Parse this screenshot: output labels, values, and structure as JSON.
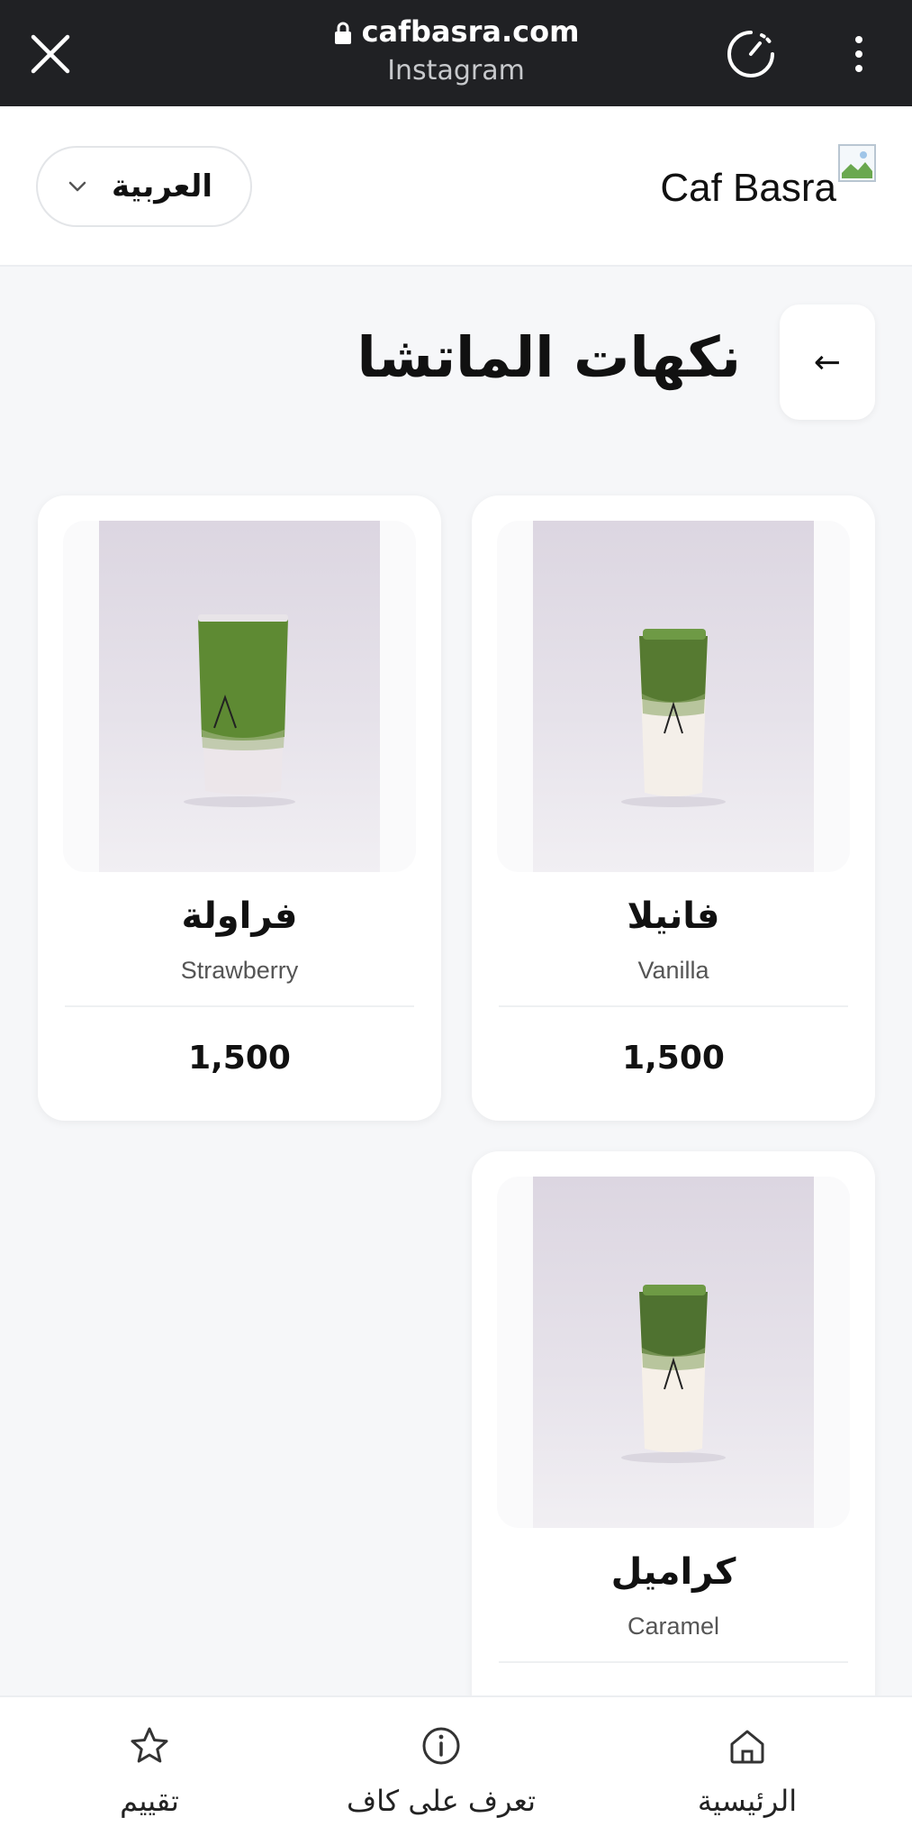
{
  "browser": {
    "url": "cafbasra.com",
    "source": "Instagram"
  },
  "header": {
    "language": "العربية",
    "brand": "Caf Basra"
  },
  "page": {
    "title": "نكهات الماتشا",
    "back_arrow": "←"
  },
  "products": [
    {
      "name_ar": "فانيلا",
      "name_en": "Vanilla",
      "price": "1,500"
    },
    {
      "name_ar": "فراولة",
      "name_en": "Strawberry",
      "price": "1,500"
    },
    {
      "name_ar": "كراميل",
      "name_en": "Caramel",
      "price": ""
    }
  ],
  "nav": {
    "home": "الرئيسية",
    "about": "تعرف على كاف",
    "rate": "تقييم"
  },
  "colors": {
    "browser_bar": "#202124",
    "page_background": "#f6f7f9",
    "matcha_green": "#5a7d35"
  }
}
